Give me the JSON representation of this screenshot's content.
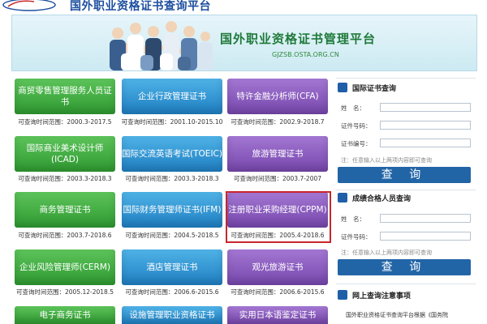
{
  "header": {
    "title": "国外职业资格证书查询平台"
  },
  "banner": {
    "title": "国外职业资格证书管理平台",
    "url": "GJZSB.OSTA.ORG.CN"
  },
  "tiles": [
    {
      "label": "商贸零售管理服务人员证书",
      "range": "可查询时间范围：2000.3-2017.5",
      "color": "green"
    },
    {
      "label": "企业行政管理证书",
      "range": "可查询时间范围：2001.10-2015.10",
      "color": "blue"
    },
    {
      "label": "特许金融分析师(CFA)",
      "range": "可查询时间范围：2002.9-2018.7",
      "color": "purple"
    },
    {
      "label": "国际商业美术设计师(ICAD)",
      "range": "可查询时间范围：2003.3-2018.3",
      "color": "green"
    },
    {
      "label": "国际交流英语考试(TOEIC)",
      "range": "可查询时间范围：2003.3-2018.3",
      "color": "blue"
    },
    {
      "label": "旅游管理证书",
      "range": "可查询时间范围：2003.7-2007",
      "color": "purple"
    },
    {
      "label": "商务管理证书",
      "range": "可查询时间范围：2003.7-2018.6",
      "color": "green"
    },
    {
      "label": "国际财务管理师证书(IFM)",
      "range": "可查询时间范围：2004.5-2018.5",
      "color": "blue"
    },
    {
      "label": "注册职业采购经理(CPPM)",
      "range": "可查询时间范围：2005.4-2018.6",
      "color": "purple"
    },
    {
      "label": "企业风险管理师(CERM)",
      "range": "可查询时间范围：2005.12-2018.5",
      "color": "green"
    },
    {
      "label": "酒店管理证书",
      "range": "可查询时间范围：2006.6-2015.6",
      "color": "blue"
    },
    {
      "label": "观光旅游证书",
      "range": "可查询时间范围：2006.6-2015.6",
      "color": "purple"
    },
    {
      "label": "电子商务证书",
      "range": "",
      "color": "green"
    },
    {
      "label": "设施管理职业资格证书",
      "range": "",
      "color": "blue"
    },
    {
      "label": "实用日本语鉴定证书",
      "range": "",
      "color": "purple"
    }
  ],
  "panel1": {
    "heading": "国际证书查询",
    "fields": [
      "姓　名：",
      "证件号码：",
      "证书编号："
    ],
    "note": "注：任意输入以上两项内容即可查询",
    "button": "查 询"
  },
  "panel2": {
    "heading": "成绩合格人员查询",
    "fields": [
      "姓　名：",
      "证件号码："
    ],
    "note": "注：任意输入以上两项内容即可查询",
    "button": "查 询"
  },
  "panel3": {
    "heading": "网上查询注意事项",
    "text": "国外职业资格证书查询平台根据《国务院"
  }
}
